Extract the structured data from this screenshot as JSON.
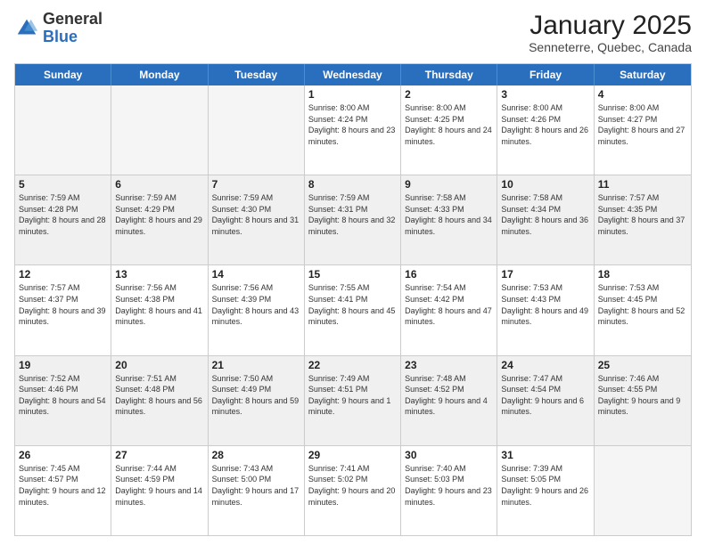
{
  "header": {
    "logo_general": "General",
    "logo_blue": "Blue",
    "month_title": "January 2025",
    "subtitle": "Senneterre, Quebec, Canada"
  },
  "weekdays": [
    "Sunday",
    "Monday",
    "Tuesday",
    "Wednesday",
    "Thursday",
    "Friday",
    "Saturday"
  ],
  "weeks": [
    [
      {
        "day": "",
        "sunrise": "",
        "sunset": "",
        "daylight": "",
        "empty": true
      },
      {
        "day": "",
        "sunrise": "",
        "sunset": "",
        "daylight": "",
        "empty": true
      },
      {
        "day": "",
        "sunrise": "",
        "sunset": "",
        "daylight": "",
        "empty": true
      },
      {
        "day": "1",
        "sunrise": "Sunrise: 8:00 AM",
        "sunset": "Sunset: 4:24 PM",
        "daylight": "Daylight: 8 hours and 23 minutes."
      },
      {
        "day": "2",
        "sunrise": "Sunrise: 8:00 AM",
        "sunset": "Sunset: 4:25 PM",
        "daylight": "Daylight: 8 hours and 24 minutes."
      },
      {
        "day": "3",
        "sunrise": "Sunrise: 8:00 AM",
        "sunset": "Sunset: 4:26 PM",
        "daylight": "Daylight: 8 hours and 26 minutes."
      },
      {
        "day": "4",
        "sunrise": "Sunrise: 8:00 AM",
        "sunset": "Sunset: 4:27 PM",
        "daylight": "Daylight: 8 hours and 27 minutes."
      }
    ],
    [
      {
        "day": "5",
        "sunrise": "Sunrise: 7:59 AM",
        "sunset": "Sunset: 4:28 PM",
        "daylight": "Daylight: 8 hours and 28 minutes."
      },
      {
        "day": "6",
        "sunrise": "Sunrise: 7:59 AM",
        "sunset": "Sunset: 4:29 PM",
        "daylight": "Daylight: 8 hours and 29 minutes."
      },
      {
        "day": "7",
        "sunrise": "Sunrise: 7:59 AM",
        "sunset": "Sunset: 4:30 PM",
        "daylight": "Daylight: 8 hours and 31 minutes."
      },
      {
        "day": "8",
        "sunrise": "Sunrise: 7:59 AM",
        "sunset": "Sunset: 4:31 PM",
        "daylight": "Daylight: 8 hours and 32 minutes."
      },
      {
        "day": "9",
        "sunrise": "Sunrise: 7:58 AM",
        "sunset": "Sunset: 4:33 PM",
        "daylight": "Daylight: 8 hours and 34 minutes."
      },
      {
        "day": "10",
        "sunrise": "Sunrise: 7:58 AM",
        "sunset": "Sunset: 4:34 PM",
        "daylight": "Daylight: 8 hours and 36 minutes."
      },
      {
        "day": "11",
        "sunrise": "Sunrise: 7:57 AM",
        "sunset": "Sunset: 4:35 PM",
        "daylight": "Daylight: 8 hours and 37 minutes."
      }
    ],
    [
      {
        "day": "12",
        "sunrise": "Sunrise: 7:57 AM",
        "sunset": "Sunset: 4:37 PM",
        "daylight": "Daylight: 8 hours and 39 minutes."
      },
      {
        "day": "13",
        "sunrise": "Sunrise: 7:56 AM",
        "sunset": "Sunset: 4:38 PM",
        "daylight": "Daylight: 8 hours and 41 minutes."
      },
      {
        "day": "14",
        "sunrise": "Sunrise: 7:56 AM",
        "sunset": "Sunset: 4:39 PM",
        "daylight": "Daylight: 8 hours and 43 minutes."
      },
      {
        "day": "15",
        "sunrise": "Sunrise: 7:55 AM",
        "sunset": "Sunset: 4:41 PM",
        "daylight": "Daylight: 8 hours and 45 minutes."
      },
      {
        "day": "16",
        "sunrise": "Sunrise: 7:54 AM",
        "sunset": "Sunset: 4:42 PM",
        "daylight": "Daylight: 8 hours and 47 minutes."
      },
      {
        "day": "17",
        "sunrise": "Sunrise: 7:53 AM",
        "sunset": "Sunset: 4:43 PM",
        "daylight": "Daylight: 8 hours and 49 minutes."
      },
      {
        "day": "18",
        "sunrise": "Sunrise: 7:53 AM",
        "sunset": "Sunset: 4:45 PM",
        "daylight": "Daylight: 8 hours and 52 minutes."
      }
    ],
    [
      {
        "day": "19",
        "sunrise": "Sunrise: 7:52 AM",
        "sunset": "Sunset: 4:46 PM",
        "daylight": "Daylight: 8 hours and 54 minutes."
      },
      {
        "day": "20",
        "sunrise": "Sunrise: 7:51 AM",
        "sunset": "Sunset: 4:48 PM",
        "daylight": "Daylight: 8 hours and 56 minutes."
      },
      {
        "day": "21",
        "sunrise": "Sunrise: 7:50 AM",
        "sunset": "Sunset: 4:49 PM",
        "daylight": "Daylight: 8 hours and 59 minutes."
      },
      {
        "day": "22",
        "sunrise": "Sunrise: 7:49 AM",
        "sunset": "Sunset: 4:51 PM",
        "daylight": "Daylight: 9 hours and 1 minute."
      },
      {
        "day": "23",
        "sunrise": "Sunrise: 7:48 AM",
        "sunset": "Sunset: 4:52 PM",
        "daylight": "Daylight: 9 hours and 4 minutes."
      },
      {
        "day": "24",
        "sunrise": "Sunrise: 7:47 AM",
        "sunset": "Sunset: 4:54 PM",
        "daylight": "Daylight: 9 hours and 6 minutes."
      },
      {
        "day": "25",
        "sunrise": "Sunrise: 7:46 AM",
        "sunset": "Sunset: 4:55 PM",
        "daylight": "Daylight: 9 hours and 9 minutes."
      }
    ],
    [
      {
        "day": "26",
        "sunrise": "Sunrise: 7:45 AM",
        "sunset": "Sunset: 4:57 PM",
        "daylight": "Daylight: 9 hours and 12 minutes."
      },
      {
        "day": "27",
        "sunrise": "Sunrise: 7:44 AM",
        "sunset": "Sunset: 4:59 PM",
        "daylight": "Daylight: 9 hours and 14 minutes."
      },
      {
        "day": "28",
        "sunrise": "Sunrise: 7:43 AM",
        "sunset": "Sunset: 5:00 PM",
        "daylight": "Daylight: 9 hours and 17 minutes."
      },
      {
        "day": "29",
        "sunrise": "Sunrise: 7:41 AM",
        "sunset": "Sunset: 5:02 PM",
        "daylight": "Daylight: 9 hours and 20 minutes."
      },
      {
        "day": "30",
        "sunrise": "Sunrise: 7:40 AM",
        "sunset": "Sunset: 5:03 PM",
        "daylight": "Daylight: 9 hours and 23 minutes."
      },
      {
        "day": "31",
        "sunrise": "Sunrise: 7:39 AM",
        "sunset": "Sunset: 5:05 PM",
        "daylight": "Daylight: 9 hours and 26 minutes."
      },
      {
        "day": "",
        "sunrise": "",
        "sunset": "",
        "daylight": "",
        "empty": true
      }
    ]
  ]
}
